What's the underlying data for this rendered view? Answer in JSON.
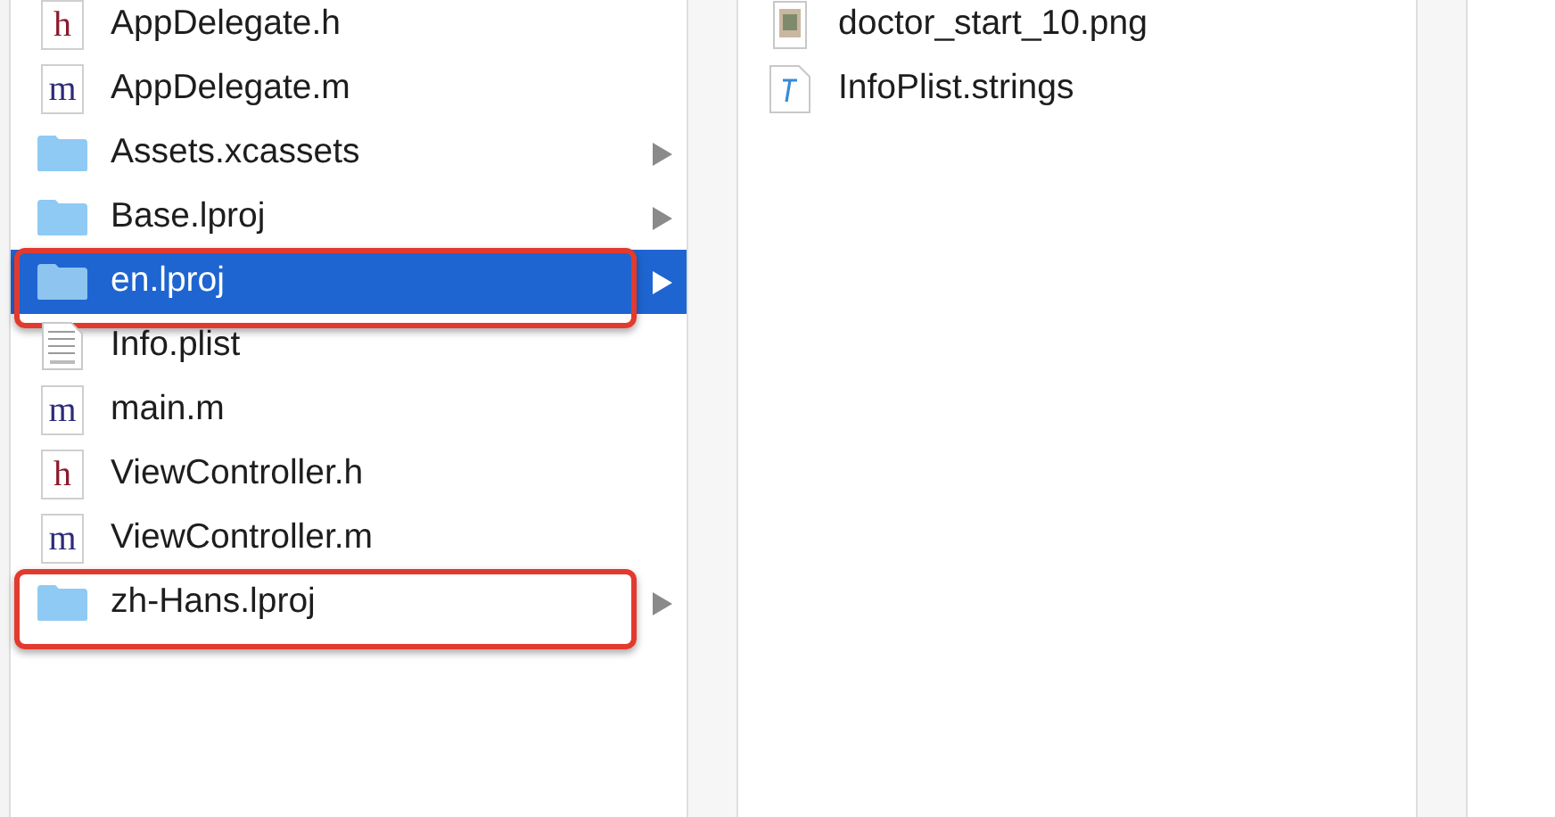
{
  "columns": [
    {
      "items": [
        {
          "name": "AppDelegate.h",
          "kind": "source",
          "icon_letter": "h",
          "selected": false,
          "highlighted": false
        },
        {
          "name": "AppDelegate.m",
          "kind": "source",
          "icon_letter": "m",
          "selected": false,
          "highlighted": false
        },
        {
          "name": "Assets.xcassets",
          "kind": "folder",
          "selected": false,
          "highlighted": false
        },
        {
          "name": "Base.lproj",
          "kind": "folder",
          "selected": false,
          "highlighted": false
        },
        {
          "name": "en.lproj",
          "kind": "folder",
          "selected": true,
          "highlighted": true
        },
        {
          "name": "Info.plist",
          "kind": "plist",
          "selected": false,
          "highlighted": false
        },
        {
          "name": "main.m",
          "kind": "source",
          "icon_letter": "m",
          "selected": false,
          "highlighted": false
        },
        {
          "name": "ViewController.h",
          "kind": "source",
          "icon_letter": "h",
          "selected": false,
          "highlighted": false
        },
        {
          "name": "ViewController.m",
          "kind": "source",
          "icon_letter": "m",
          "selected": false,
          "highlighted": false
        },
        {
          "name": "zh-Hans.lproj",
          "kind": "folder",
          "selected": false,
          "highlighted": true
        }
      ]
    },
    {
      "items": [
        {
          "name": "doctor_start_10.png",
          "kind": "image",
          "selected": false,
          "highlighted": false
        },
        {
          "name": "InfoPlist.strings",
          "kind": "strings",
          "selected": false,
          "highlighted": false
        }
      ]
    }
  ]
}
